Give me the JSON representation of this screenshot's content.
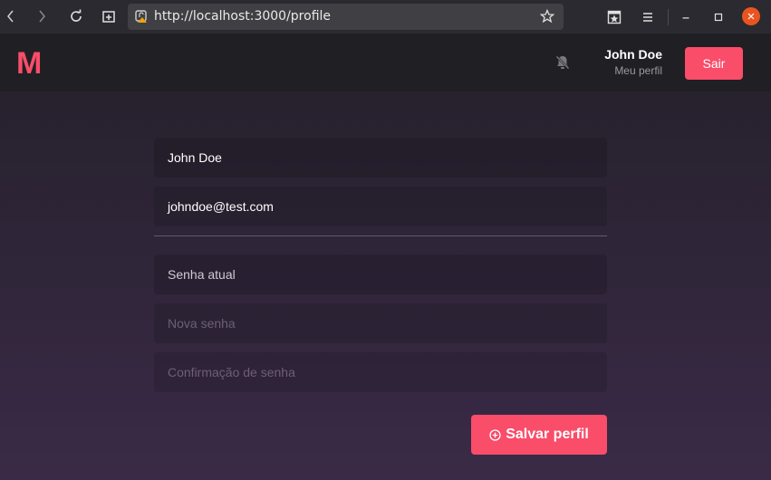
{
  "browser": {
    "url": "http://localhost:3000/profile",
    "icons": {
      "back": "chevron-left-icon",
      "forward": "chevron-right-icon",
      "reload": "reload-icon",
      "new_tab": "new-tab-icon",
      "site_info": "insecure-lock-icon",
      "bookmark": "star-icon",
      "extension": "extension-icon",
      "menu": "hamburger-menu-icon",
      "minimize": "minimize-icon",
      "maximize": "maximize-icon",
      "close": "close-icon"
    },
    "colors": {
      "close_button": "#e95420"
    }
  },
  "header": {
    "logo": "M",
    "notifications_icon": "bell-off-icon",
    "user_name": "John Doe",
    "profile_link": "Meu perfil",
    "logout_label": "Sair"
  },
  "form": {
    "name_value": "John Doe",
    "email_value": "johndoe@test.com",
    "current_password_placeholder": "Senha atual",
    "new_password_placeholder": "Nova senha",
    "confirm_password_placeholder": "Confirmação de senha",
    "save_label": "Salvar perfil",
    "save_icon": "plus-circle-icon"
  },
  "colors": {
    "accent": "#f94d6a",
    "header_bg": "#201f23",
    "gradient_top": "#27222e",
    "gradient_bottom": "#3a2a47"
  }
}
